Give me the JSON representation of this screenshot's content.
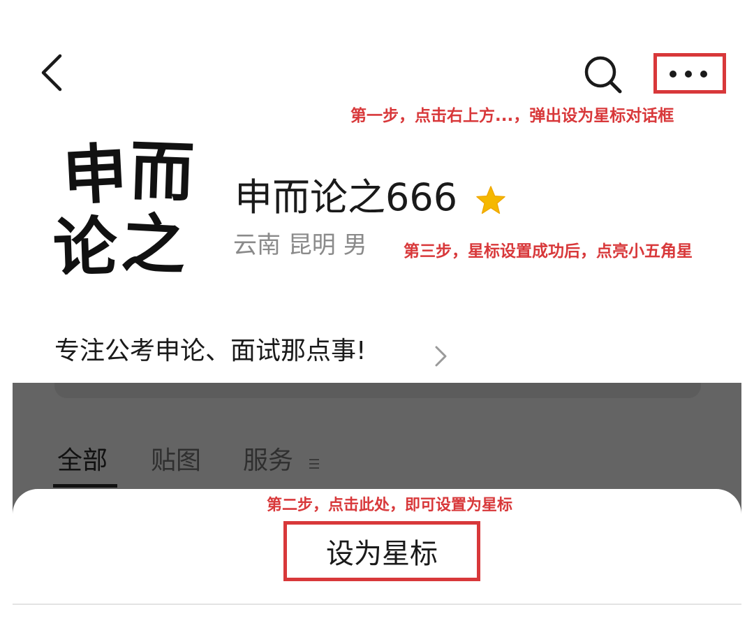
{
  "annotations": {
    "step1": "第一步，点击右上方...，弹出设为星标对话框",
    "step2": "第二步，点击此处，即可设置为星标",
    "step3": "第三步，星标设置成功后，点亮小五角星",
    "color": "#d8383a"
  },
  "header": {
    "back_icon": "chevron-left-icon",
    "search_icon": "search-icon",
    "more_icon": "more-horizontal-icon"
  },
  "profile": {
    "avatar_chars": [
      "申",
      "而",
      "论",
      "之"
    ],
    "name": "申而论之666",
    "location": "云南 昆明 男",
    "starred": true,
    "star_color": "#f5b800",
    "bio": "专注公考申论、面试那点事!",
    "bio_chevron_icon": "chevron-right-icon"
  },
  "tabs": [
    {
      "label": "全部",
      "active": true
    },
    {
      "label": "贴图",
      "active": false
    },
    {
      "label": "服务",
      "active": false
    }
  ],
  "sheet": {
    "action_label": "设为星标"
  }
}
